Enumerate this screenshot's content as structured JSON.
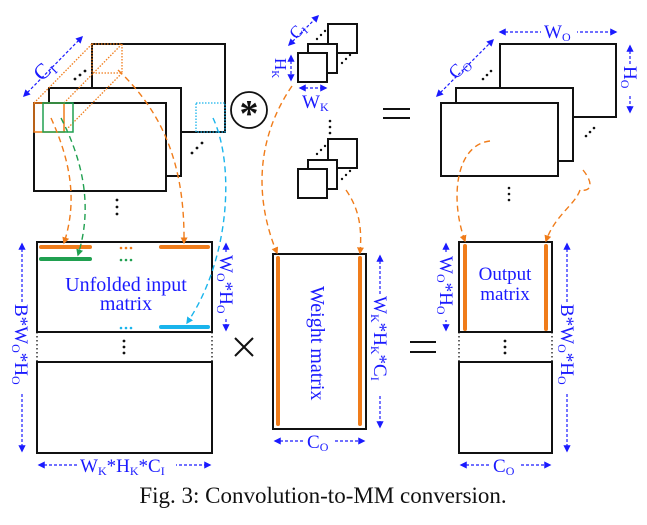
{
  "caption": "Fig. 3: Convolution-to-MM conversion.",
  "colors": {
    "label": "#1a1aff",
    "orange": "#f07c1a",
    "green": "#20a050",
    "cyan": "#19b4ec",
    "black": "#111111"
  },
  "input_tensor": {
    "depth_label": "C",
    "depth_sub": "I"
  },
  "kernel": {
    "depth_label": "C",
    "depth_sub": "I",
    "height_label": "H",
    "height_sub": "K",
    "width_label": "W",
    "width_sub": "K"
  },
  "output_tensor": {
    "width_label": "W",
    "width_sub": "O",
    "height_label": "H",
    "height_sub": "O",
    "depth_label": "C",
    "depth_sub": "O"
  },
  "operators": {
    "convolution": "⊛",
    "convolution_star": "*",
    "equals": "=",
    "times": "×"
  },
  "unfolded_matrix": {
    "title_line1": "Unfolded input",
    "title_line2": "matrix",
    "rows_label": "B*Wₒ*Hₒ",
    "rows_parts": [
      "B*W",
      "O",
      "*H",
      "O"
    ],
    "block_label_parts": [
      "W",
      "O",
      "*H",
      "O"
    ],
    "cols_label_parts": [
      "W",
      "K",
      "*H",
      "K",
      "*C",
      "I"
    ]
  },
  "weight_matrix": {
    "title": "Weight matrix",
    "rows_label_parts": [
      "W",
      "K",
      "*H",
      "K",
      "*C",
      "I"
    ],
    "cols_label_parts": [
      "C",
      "O"
    ]
  },
  "output_matrix": {
    "title_line1": "Output",
    "title_line2": "matrix",
    "rows_label_parts": [
      "B*W",
      "O",
      "*H",
      "O"
    ],
    "block_label_parts": [
      "W",
      "O",
      "*H",
      "O"
    ],
    "cols_label_parts": [
      "C",
      "O"
    ]
  }
}
